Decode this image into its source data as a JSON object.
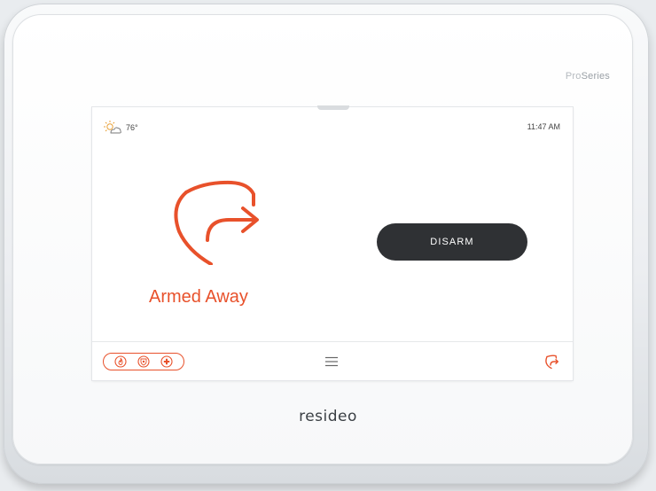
{
  "device": {
    "series_prefix": "Pro",
    "series_suffix": "Series",
    "brand": "resideo"
  },
  "status_bar": {
    "weather_icon": "partly-cloudy-icon",
    "temperature": "76°",
    "time": "11:47 AM"
  },
  "main": {
    "status_icon": "armed-away-shield-icon",
    "status_label": "Armed Away",
    "disarm_label": "DISARM"
  },
  "bottom_bar": {
    "panic_icons": [
      "fire-icon",
      "police-icon",
      "medical-icon"
    ],
    "menu_icon": "hamburger-menu-icon",
    "arm_status_icon": "armed-away-small-icon"
  },
  "colors": {
    "accent": "#e8512b",
    "button": "#2f3134",
    "text": "#444444"
  }
}
